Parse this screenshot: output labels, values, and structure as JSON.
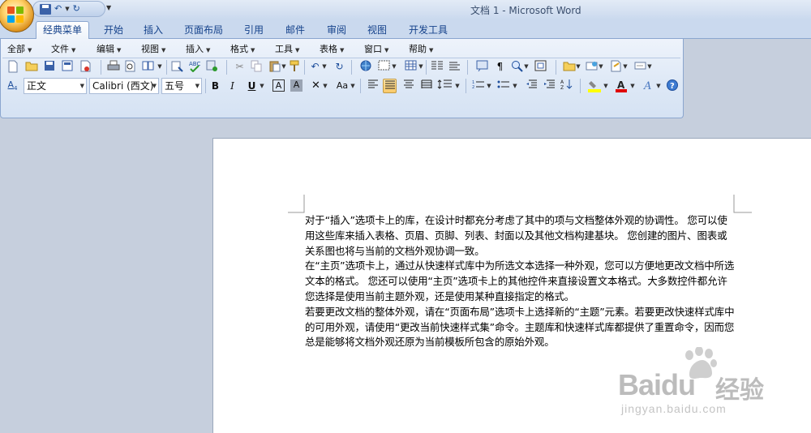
{
  "window": {
    "title": "文档 1 - Microsoft Word"
  },
  "tabs": [
    "经典菜单",
    "开始",
    "插入",
    "页面布局",
    "引用",
    "邮件",
    "审阅",
    "视图",
    "开发工具"
  ],
  "menus": [
    "全部",
    "文件",
    "编辑",
    "视图",
    "插入",
    "格式",
    "工具",
    "表格",
    "窗口",
    "帮助"
  ],
  "format": {
    "style": "正文",
    "font": "Calibri (西文)",
    "size": "五号"
  },
  "document": {
    "paragraphs": [
      "对于“插入”选项卡上的库，在设计时都充分考虑了其中的项与文档整体外观的协调性。 您可以使用这些库来插入表格、页眉、页脚、列表、封面以及其他文档构建基块。 您创建的图片、图表或关系图也将与当前的文档外观协调一致。",
      "在“主页”选项卡上，通过从快速样式库中为所选文本选择一种外观，您可以方便地更改文档中所选文本的格式。 您还可以使用“主页”选项卡上的其他控件来直接设置文本格式。大多数控件都允许您选择是使用当前主题外观，还是使用某种直接指定的格式。",
      "若要更改文档的整体外观，请在“页面布局”选项卡上选择新的“主题”元素。若要更改快速样式库中的可用外观，请使用“更改当前快速样式集”命令。主题库和快速样式库都提供了重置命令，因而您总是能够将文档外观还原为当前模板所包含的原始外观。"
    ]
  },
  "watermark": {
    "brand": "Baidu",
    "cn": "经验",
    "url": "jingyan.baidu.com"
  },
  "colors": {
    "ribbon": "#dde8f6",
    "highlight": "#ffff00",
    "font_color": "#e00000"
  }
}
